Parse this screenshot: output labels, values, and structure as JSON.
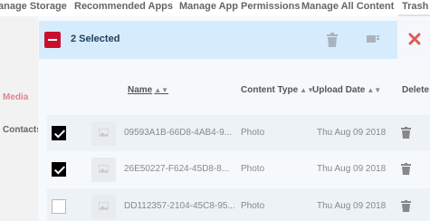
{
  "topnav": {
    "tabs": [
      {
        "label": "anage Storage"
      },
      {
        "label": "Recommended Apps"
      },
      {
        "label": "Manage App Permissions"
      },
      {
        "label": "Manage All Content"
      },
      {
        "label": "Trash"
      }
    ]
  },
  "sidebar": {
    "items": [
      {
        "label": "Media",
        "color": "#e1858f"
      },
      {
        "label": "Contacts"
      }
    ]
  },
  "selection_bar": {
    "selected_label": "2 Selected",
    "icons": [
      "minus-icon",
      "trash-icon",
      "move-to-folder-icon",
      "close-icon"
    ],
    "accent": "#c8102e",
    "background": "#d6ebfb"
  },
  "table": {
    "headers": {
      "name": "Name",
      "content_type": "Content Type",
      "upload_date": "Upload Date",
      "delete": "Delete"
    },
    "rows": [
      {
        "checked": true,
        "name": "09593A1B-66D8-4AB4-9...",
        "type": "Photo",
        "date": "Thu Aug 09 2018"
      },
      {
        "checked": true,
        "name": "26E50227-F624-45D8-8...",
        "type": "Photo",
        "date": "Thu Aug 09 2018"
      },
      {
        "checked": false,
        "name": "DD112357-2104-45C8-95...",
        "type": "Photo",
        "date": "Thu Aug 09 2018"
      }
    ]
  }
}
